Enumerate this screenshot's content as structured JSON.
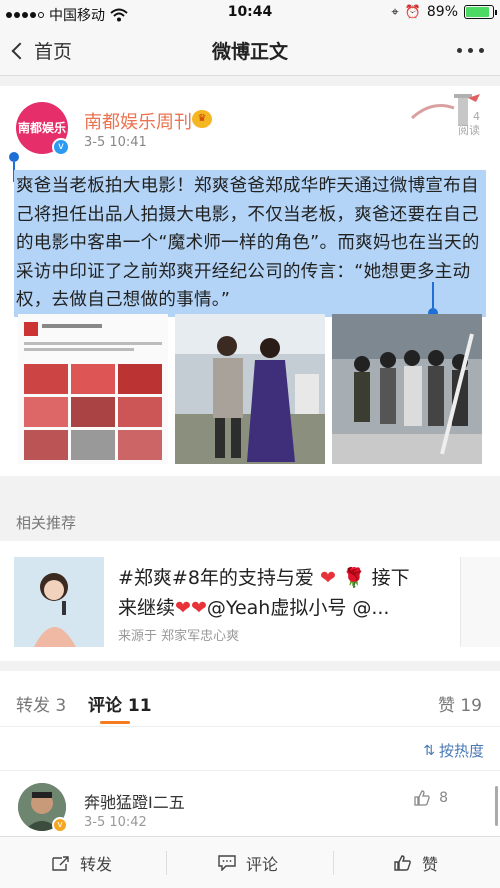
{
  "status_bar": {
    "carrier": "中国移动",
    "time": "10:44",
    "battery": "89%",
    "battery_level": 0.89
  },
  "nav": {
    "back_label": "首页",
    "title": "微博正文"
  },
  "post": {
    "avatar_label": "南都娱乐",
    "author": "南都娱乐周刊",
    "time": "3-5 10:41",
    "reads_count": "4",
    "reads_label": "阅读",
    "text": "爽爸当老板拍大电影！郑爽爸爸郑成华昨天通过微博宣布自己将担任出品人拍摄大电影，不仅当老板，爽爸还要在自己的电影中客串一个“魔术师一样的角色”。而爽妈也在当天的采访中印证了之前郑爽开经纪公司的传言：“她想更多主动权，去做自己想做的事情。”"
  },
  "recommend": {
    "section_title": "相关推荐",
    "line1": "#郑爽#8年的支持与爱",
    "line1b": "接下",
    "line2a": "来继续",
    "line2b": "@Yeah虚拟小号 @...",
    "source": "来源于 郑家军忠心爽"
  },
  "tabs": {
    "repost": "转发 3",
    "comment": "评论 11",
    "like": "赞 19"
  },
  "sort_label": "按热度",
  "comment": {
    "name": "奔驰猛蹬I二五",
    "time": "3-5 10:42",
    "likes": "8"
  },
  "bottom": {
    "repost": "转发",
    "comment": "评论",
    "like": "赞"
  }
}
